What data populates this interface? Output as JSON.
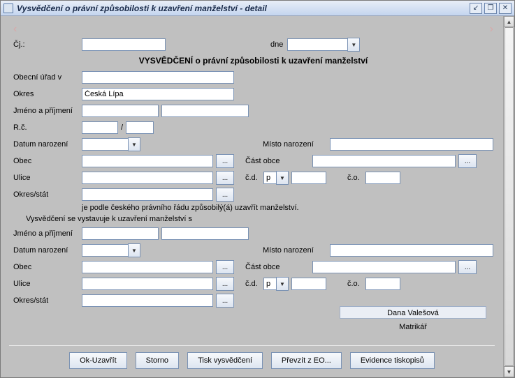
{
  "title": "Vysvědčení o právní způsobilosti k uzavření manželství - detail",
  "nav": {
    "prev": "‹",
    "next": "›"
  },
  "cj_label": "Čj.:",
  "dne_label": "dne",
  "heading_prefix": "VYSVĚDČENÍ ",
  "heading_rest": "o právní způsobilosti k uzavření manželství",
  "labels": {
    "obecni_urad": "Obecní úřad v",
    "okres": "Okres",
    "jmeno": "Jméno a příjmení",
    "rc": "R.č.",
    "rc_sep": "/",
    "datum_nar": "Datum narození",
    "misto_nar": "Místo narození",
    "obec": "Obec",
    "cast_obce": "Část obce",
    "ulice": "Ulice",
    "cd": "č.d.",
    "co": "č.o.",
    "okres_stat": "Okres/stát",
    "p": "p"
  },
  "statement1": "je podle českého právního řádu způsobilý(á) uzavřít manželství.",
  "statement2": "Vysvědčení se vystavuje k uzavření manželství s",
  "okres_value": "Česká Lípa",
  "registrar_name": "Dana Valešová",
  "registrar_role": "Matrikář",
  "buttons": {
    "ok": "Ok-Uzavřít",
    "storno": "Storno",
    "tisk": "Tisk vysvědčení",
    "prevzit": "Převzít z EO...",
    "evidence": "Evidence tiskopisů"
  },
  "ellipsis": "..."
}
